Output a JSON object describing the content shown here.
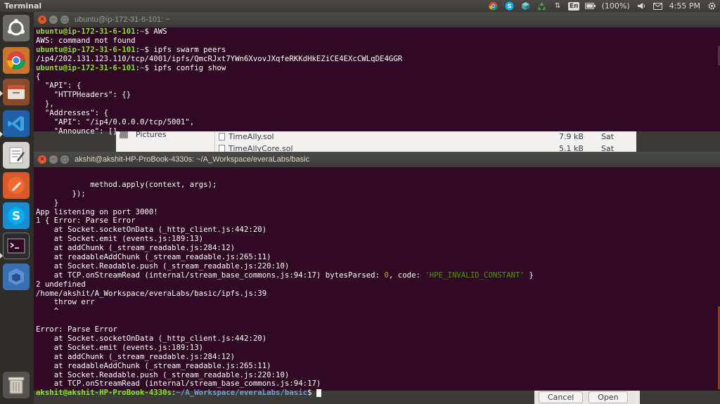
{
  "top_panel": {
    "app_title": "Terminal",
    "battery": "(100%)",
    "time": "4:55 PM",
    "keyboard_layout": "En",
    "tray_icons": [
      "chrome-icon",
      "skype-icon",
      "cube-icon",
      "recycle-icon",
      "network-updown-icon",
      "keyboard-layout-icon",
      "battery-icon",
      "volume-icon",
      "mail-icon",
      "clock",
      "power-gear-icon"
    ]
  },
  "launcher": {
    "items": [
      "ubuntu-dash-icon",
      "chrome-icon",
      "files-icon",
      "vscode-icon",
      "text-editor-icon",
      "postman-icon",
      "skype-icon",
      "terminal-icon",
      "virtualbox-icon",
      "trash-icon"
    ]
  },
  "background_file_manager": {
    "sidebar_label": "Pictures",
    "rows": [
      {
        "name": "TimeAlly.sol",
        "size": "7.9 kB",
        "date": "Sat"
      },
      {
        "name": "TimeAllyCore.sol",
        "size": "5.1 kB",
        "date": "Sat"
      }
    ]
  },
  "background_dialog": {
    "cancel_label": "Cancel",
    "open_label": "Open"
  },
  "terminal_top": {
    "title": "ubuntu@ip-172-31-6-101: ~",
    "lines": [
      {
        "prompt_user": "ubuntu@ip-172-31-6-101",
        "prompt_path": "~",
        "command": "AWS"
      },
      {
        "text": "AWS: command not found"
      },
      {
        "prompt_user": "ubuntu@ip-172-31-6-101",
        "prompt_path": "~",
        "command": "ipfs swarm peers"
      },
      {
        "text": "/ip4/202.131.123.110/tcp/4001/ipfs/QmcRJxt7YWn6XvovJXqfeRKKdHkEZiCE4EXcCWLqDE4GGR"
      },
      {
        "prompt_user": "ubuntu@ip-172-31-6-101",
        "prompt_path": "~",
        "command": "ipfs config show"
      },
      {
        "text": "{"
      },
      {
        "text": "  \"API\": {"
      },
      {
        "text": "    \"HTTPHeaders\": {}"
      },
      {
        "text": "  },"
      },
      {
        "text": "  \"Addresses\": {"
      },
      {
        "text": "    \"API\": \"/ip4/0.0.0.0/tcp/5001\","
      },
      {
        "text": "    \"Announce\": [],"
      }
    ]
  },
  "terminal_main": {
    "title": "akshit@akshit-HP-ProBook-4330s: ~/A_Workspace/everaLabs/basic",
    "lines": [
      "",
      "            method.apply(context, args);",
      "        });",
      "    }",
      "App listening on port 3000!",
      "1 { Error: Parse Error",
      "    at Socket.socketOnData (_http_client.js:442:20)",
      "    at Socket.emit (events.js:189:13)",
      "    at addChunk (_stream_readable.js:284:12)",
      "    at readableAddChunk (_stream_readable.js:265:11)",
      "    at Socket.Readable.push (_stream_readable.js:220:10)",
      "__SPECIAL__",
      "2 undefined",
      "/home/akshit/A_Workspace/everaLabs/basic/ipfs.js:39",
      "    throw err",
      "    ^",
      "",
      "Error: Parse Error",
      "    at Socket.socketOnData (_http_client.js:442:20)",
      "    at Socket.emit (events.js:189:13)",
      "    at addChunk (_stream_readable.js:284:12)",
      "    at readableAddChunk (_stream_readable.js:265:11)",
      "    at Socket.Readable.push (_stream_readable.js:220:10)",
      "    at TCP.onStreamRead (internal/stream_base_commons.js:94:17)"
    ],
    "special_line": {
      "prefix": "    at TCP.onStreamRead (internal/stream_base_commons.js:94:17) bytesParsed: ",
      "bytes": "0",
      "middle": ", code: ",
      "code": "'HPE_INVALID_CONSTANT'",
      "suffix": " }"
    },
    "prompt": {
      "user": "akshit@akshit-HP-ProBook-4330s",
      "path": "~/A_Workspace/everaLabs/basic",
      "symbol": "$ "
    }
  },
  "colors": {
    "terminal_bg": "#300a24",
    "prompt_user": "#8ae234",
    "prompt_path": "#729fcf",
    "string": "#4e9a06",
    "number": "#c4a000",
    "scrollbar_thumb": "#9b3a0f"
  }
}
